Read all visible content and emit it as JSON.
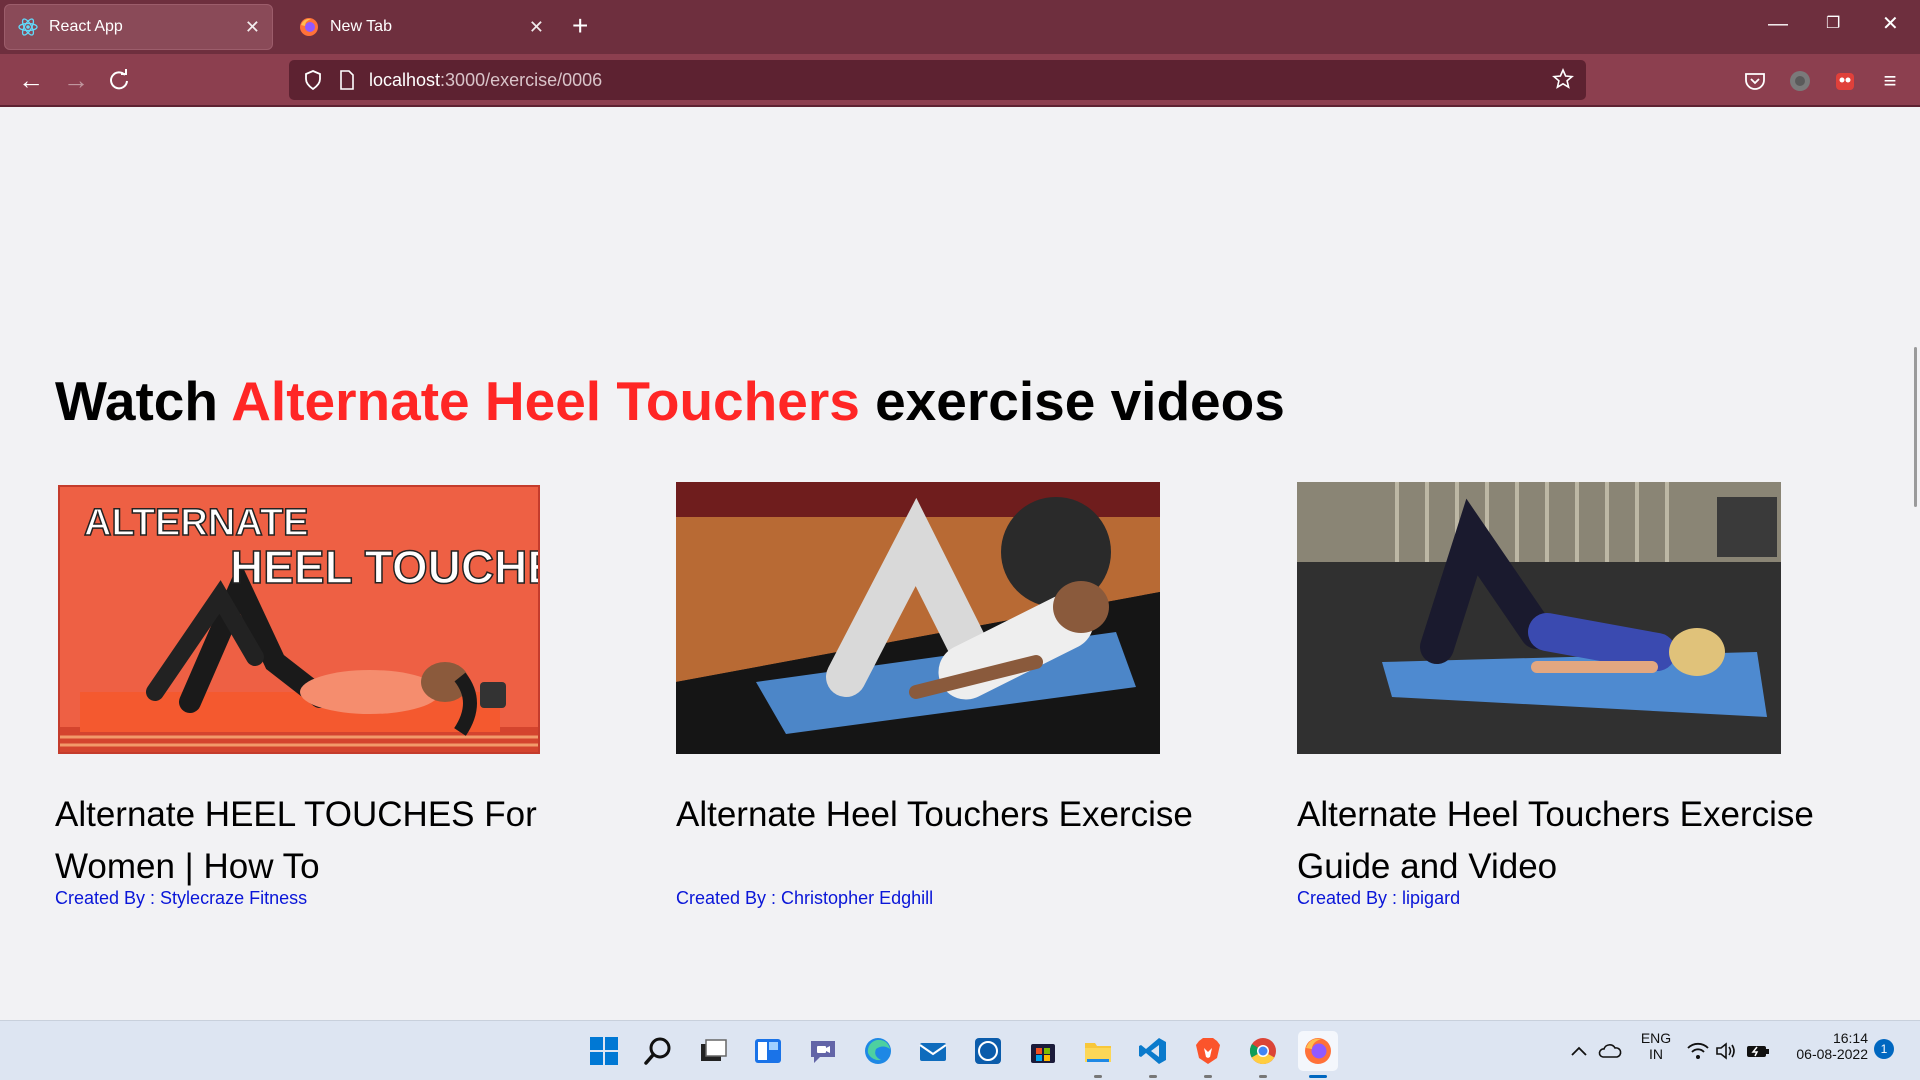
{
  "browser": {
    "tabs": [
      {
        "title": "React App",
        "icon": "react-icon",
        "active": true
      },
      {
        "title": "New Tab",
        "icon": "firefox-icon",
        "active": false
      }
    ],
    "new_tab_label": "+",
    "url_host": "localhost",
    "url_path": ":3000/exercise/0006"
  },
  "page": {
    "heading_prefix": "Watch ",
    "heading_accent": "Alternate Heel Touchers",
    "heading_suffix": " exercise videos",
    "accent_color": "#ff2625",
    "channel_color": "#0a16d8",
    "videos": [
      {
        "title": "Alternate HEEL TOUCHES For Women | How To",
        "channel": "Created By : Stylecraze Fitness",
        "thumb_text_1": "ALTERNATE",
        "thumb_text_2": "HEEL TOUCHES"
      },
      {
        "title": "Alternate Heel Touchers Exercise",
        "channel": "Created By : Christopher Edghill"
      },
      {
        "title": "Alternate Heel Touchers Exercise Guide and Video",
        "channel": "Created By : lipigard"
      }
    ]
  },
  "taskbar": {
    "apps": [
      "windows-start-icon",
      "search-icon",
      "task-view-icon",
      "widgets-icon",
      "teams-chat-icon",
      "edge-icon",
      "mail-icon",
      "dell-icon",
      "store-icon",
      "file-explorer-icon",
      "vscode-icon",
      "brave-icon",
      "chrome-icon",
      "firefox-icon"
    ],
    "lang_1": "ENG",
    "lang_2": "IN",
    "time": "16:14",
    "date": "06-08-2022",
    "notifications": "1"
  }
}
